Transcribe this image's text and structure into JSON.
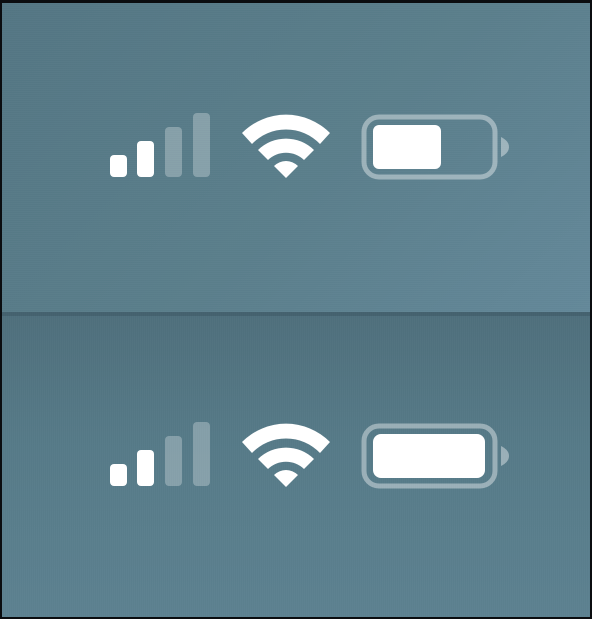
{
  "colors": {
    "background_top": "#5a7e8b",
    "background_bottom": "#557886",
    "icon_fill": "#ffffff",
    "icon_dim": "rgba(255,255,255,0.30)"
  },
  "status_bars": [
    {
      "cellular": {
        "icon": "cellular-signal-icon",
        "active_bars": 2,
        "total_bars": 4
      },
      "wifi": {
        "icon": "wifi-icon",
        "level": "full"
      },
      "battery": {
        "icon": "battery-icon",
        "charge_fraction": 0.5
      }
    },
    {
      "cellular": {
        "icon": "cellular-signal-icon",
        "active_bars": 2,
        "total_bars": 4
      },
      "wifi": {
        "icon": "wifi-icon",
        "level": "full"
      },
      "battery": {
        "icon": "battery-icon",
        "charge_fraction": 0.95
      }
    }
  ]
}
